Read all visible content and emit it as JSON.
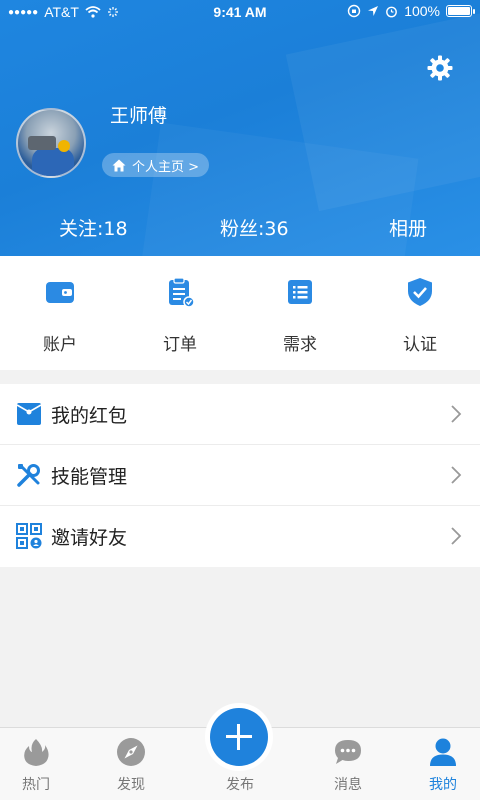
{
  "status_bar": {
    "carrier": "AT&T",
    "time": "9:41 AM",
    "battery": "100%"
  },
  "profile": {
    "name": "王师傅",
    "homepage_label": "个人主页 >",
    "stats": {
      "following": "关注:18",
      "fans": "粉丝:36",
      "album": "相册"
    }
  },
  "quick_actions": [
    {
      "label": "账户",
      "icon": "wallet-icon"
    },
    {
      "label": "订单",
      "icon": "order-clipboard-icon"
    },
    {
      "label": "需求",
      "icon": "list-icon"
    },
    {
      "label": "认证",
      "icon": "shield-check-icon"
    }
  ],
  "menu": [
    {
      "label": "我的红包",
      "icon": "red-packet-icon"
    },
    {
      "label": "技能管理",
      "icon": "tools-icon"
    },
    {
      "label": "邀请好友",
      "icon": "qr-code-icon"
    }
  ],
  "tabs": [
    {
      "label": "热门",
      "icon": "flame-icon"
    },
    {
      "label": "发现",
      "icon": "compass-icon"
    },
    {
      "label": "发布",
      "icon": "plus-icon"
    },
    {
      "label": "消息",
      "icon": "chat-bubble-icon"
    },
    {
      "label": "我的",
      "icon": "person-icon",
      "active": true
    }
  ],
  "colors": {
    "primary": "#1f82dc",
    "header_bg": "#1f86e0",
    "inactive_tab": "#9a9a9a"
  }
}
